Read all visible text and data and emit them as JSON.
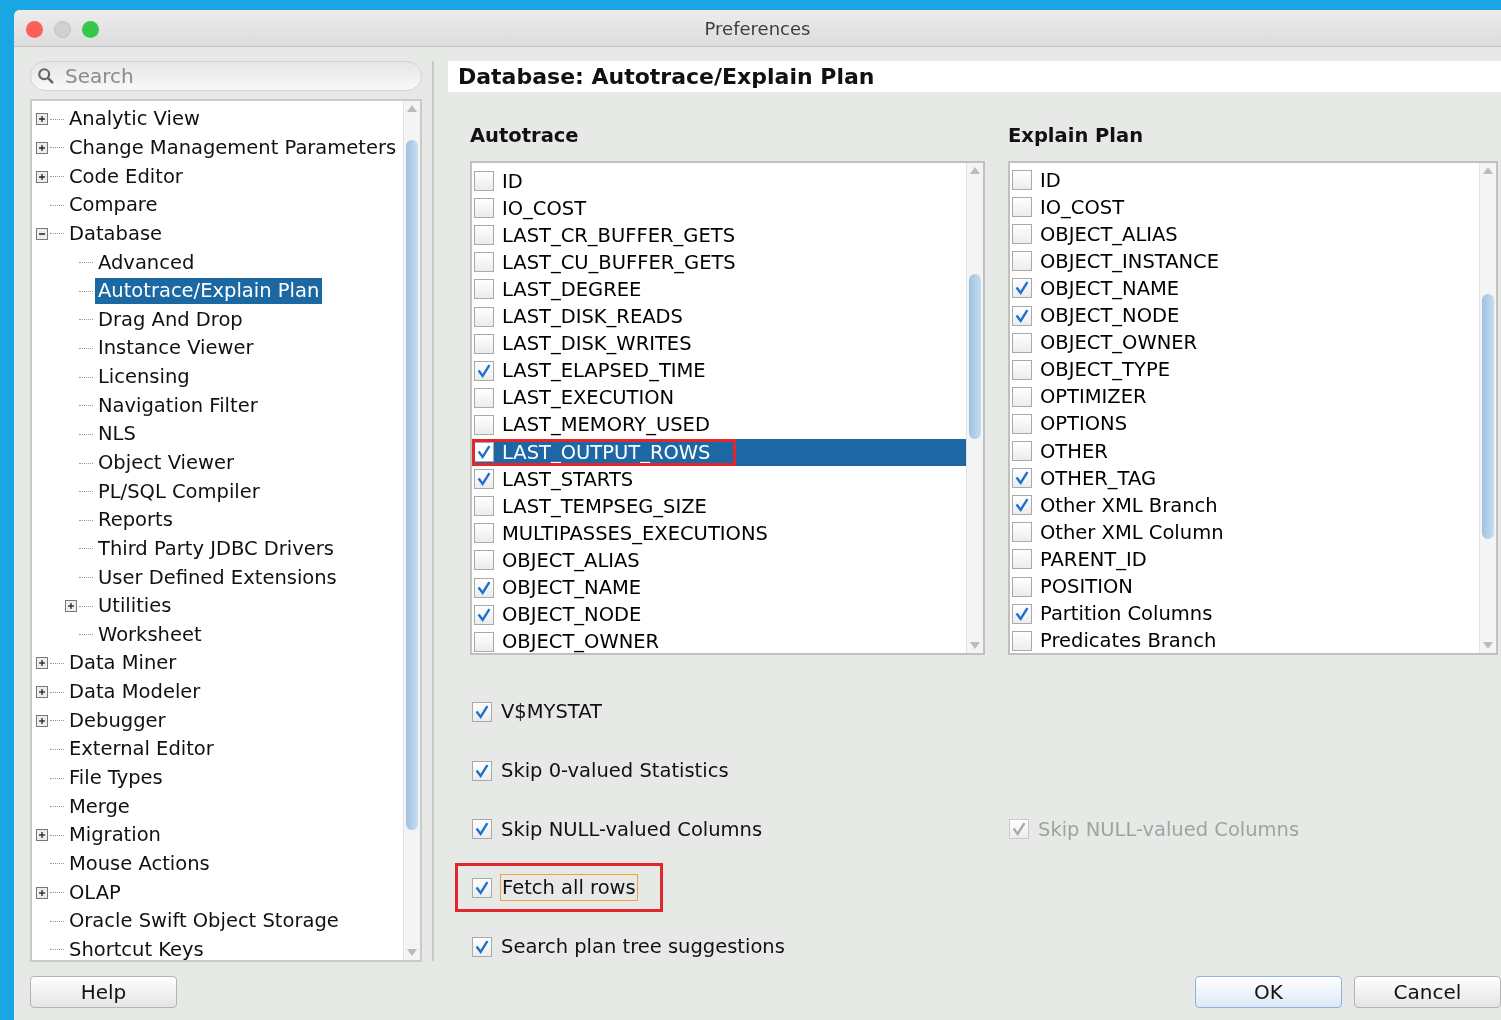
{
  "window": {
    "title": "Preferences"
  },
  "sidebar": {
    "search": {
      "placeholder": "Search"
    },
    "tree": [
      {
        "label": "Analytic View",
        "kind": "group",
        "expanded": false,
        "selected": false
      },
      {
        "label": "Change Management Parameters",
        "kind": "group",
        "expanded": false,
        "selected": false
      },
      {
        "label": "Code Editor",
        "kind": "group",
        "expanded": false,
        "selected": false
      },
      {
        "label": "Compare",
        "kind": "page",
        "selected": false
      },
      {
        "label": "Database",
        "kind": "group",
        "expanded": true,
        "selected": false,
        "children": [
          {
            "label": "Advanced",
            "kind": "page",
            "selected": false
          },
          {
            "label": "Autotrace/Explain Plan",
            "kind": "page",
            "selected": true
          },
          {
            "label": "Drag And Drop",
            "kind": "page",
            "selected": false
          },
          {
            "label": "Instance Viewer",
            "kind": "page",
            "selected": false
          },
          {
            "label": "Licensing",
            "kind": "page",
            "selected": false
          },
          {
            "label": "Navigation Filter",
            "kind": "page",
            "selected": false
          },
          {
            "label": "NLS",
            "kind": "page",
            "selected": false
          },
          {
            "label": "Object Viewer",
            "kind": "page",
            "selected": false
          },
          {
            "label": "PL/SQL Compiler",
            "kind": "page",
            "selected": false
          },
          {
            "label": "Reports",
            "kind": "page",
            "selected": false
          },
          {
            "label": "Third Party JDBC Drivers",
            "kind": "page",
            "selected": false
          },
          {
            "label": "User Defined Extensions",
            "kind": "page",
            "selected": false
          },
          {
            "label": "Utilities",
            "kind": "group",
            "expanded": false,
            "selected": false
          },
          {
            "label": "Worksheet",
            "kind": "page",
            "selected": false
          }
        ]
      },
      {
        "label": "Data Miner",
        "kind": "group",
        "expanded": false,
        "selected": false
      },
      {
        "label": "Data Modeler",
        "kind": "group",
        "expanded": false,
        "selected": false
      },
      {
        "label": "Debugger",
        "kind": "group",
        "expanded": false,
        "selected": false
      },
      {
        "label": "External Editor",
        "kind": "page",
        "selected": false
      },
      {
        "label": "File Types",
        "kind": "page",
        "selected": false
      },
      {
        "label": "Merge",
        "kind": "page",
        "selected": false
      },
      {
        "label": "Migration",
        "kind": "group",
        "expanded": false,
        "selected": false
      },
      {
        "label": "Mouse Actions",
        "kind": "page",
        "selected": false
      },
      {
        "label": "OLAP",
        "kind": "group",
        "expanded": false,
        "selected": false
      },
      {
        "label": "Oracle Swift Object Storage",
        "kind": "page",
        "selected": false
      },
      {
        "label": "Shortcut Keys",
        "kind": "page",
        "selected": false
      }
    ]
  },
  "page": {
    "title": "Database: Autotrace/Explain Plan",
    "autotrace": {
      "heading": "Autotrace",
      "columns": [
        {
          "label": "ID",
          "checked": false,
          "selected": false,
          "highlighted": false
        },
        {
          "label": "IO_COST",
          "checked": false,
          "selected": false,
          "highlighted": false
        },
        {
          "label": "LAST_CR_BUFFER_GETS",
          "checked": false,
          "selected": false,
          "highlighted": false
        },
        {
          "label": "LAST_CU_BUFFER_GETS",
          "checked": false,
          "selected": false,
          "highlighted": false
        },
        {
          "label": "LAST_DEGREE",
          "checked": false,
          "selected": false,
          "highlighted": false
        },
        {
          "label": "LAST_DISK_READS",
          "checked": false,
          "selected": false,
          "highlighted": false
        },
        {
          "label": "LAST_DISK_WRITES",
          "checked": false,
          "selected": false,
          "highlighted": false
        },
        {
          "label": "LAST_ELAPSED_TIME",
          "checked": true,
          "selected": false,
          "highlighted": false
        },
        {
          "label": "LAST_EXECUTION",
          "checked": false,
          "selected": false,
          "highlighted": false
        },
        {
          "label": "LAST_MEMORY_USED",
          "checked": false,
          "selected": false,
          "highlighted": false
        },
        {
          "label": "LAST_OUTPUT_ROWS",
          "checked": true,
          "selected": true,
          "highlighted": true
        },
        {
          "label": "LAST_STARTS",
          "checked": true,
          "selected": false,
          "highlighted": false
        },
        {
          "label": "LAST_TEMPSEG_SIZE",
          "checked": false,
          "selected": false,
          "highlighted": false
        },
        {
          "label": "MULTIPASSES_EXECUTIONS",
          "checked": false,
          "selected": false,
          "highlighted": false
        },
        {
          "label": "OBJECT_ALIAS",
          "checked": false,
          "selected": false,
          "highlighted": false
        },
        {
          "label": "OBJECT_NAME",
          "checked": true,
          "selected": false,
          "highlighted": false
        },
        {
          "label": "OBJECT_NODE",
          "checked": true,
          "selected": false,
          "highlighted": false
        },
        {
          "label": "OBJECT_OWNER",
          "checked": false,
          "selected": false,
          "highlighted": false
        }
      ]
    },
    "explain_plan": {
      "heading": "Explain Plan",
      "columns": [
        {
          "label": "ID",
          "checked": false
        },
        {
          "label": "IO_COST",
          "checked": false
        },
        {
          "label": "OBJECT_ALIAS",
          "checked": false
        },
        {
          "label": "OBJECT_INSTANCE",
          "checked": false
        },
        {
          "label": "OBJECT_NAME",
          "checked": true
        },
        {
          "label": "OBJECT_NODE",
          "checked": true
        },
        {
          "label": "OBJECT_OWNER",
          "checked": false
        },
        {
          "label": "OBJECT_TYPE",
          "checked": false
        },
        {
          "label": "OPTIMIZER",
          "checked": false
        },
        {
          "label": "OPTIONS",
          "checked": false
        },
        {
          "label": "OTHER",
          "checked": false
        },
        {
          "label": "OTHER_TAG",
          "checked": true
        },
        {
          "label": "Other XML Branch",
          "checked": true
        },
        {
          "label": "Other XML Column",
          "checked": false
        },
        {
          "label": "PARENT_ID",
          "checked": false
        },
        {
          "label": "POSITION",
          "checked": false
        },
        {
          "label": "Partition Columns",
          "checked": true
        },
        {
          "label": "Predicates Branch",
          "checked": false
        }
      ]
    },
    "options": [
      {
        "autotrace": {
          "label": "V$MYSTAT",
          "checked": true,
          "highlighted": false,
          "focused": false
        }
      },
      {
        "autotrace": {
          "label": "Skip 0-valued Statistics",
          "checked": true,
          "highlighted": false,
          "focused": false
        }
      },
      {
        "autotrace": {
          "label": "Skip NULL-valued Columns",
          "checked": true,
          "highlighted": false,
          "focused": false
        },
        "explain_plan": {
          "label": "Skip NULL-valued Columns",
          "checked": true,
          "disabled": true
        }
      },
      {
        "autotrace": {
          "label": "Fetch all rows",
          "checked": true,
          "highlighted": true,
          "focused": true
        }
      },
      {
        "autotrace": {
          "label": "Search plan tree suggestions",
          "checked": true,
          "highlighted": false,
          "focused": false
        }
      }
    ]
  },
  "buttons": [
    {
      "label": "Help",
      "kind": "secondary"
    },
    {
      "label": "OK",
      "kind": "default"
    },
    {
      "label": "Cancel",
      "kind": "secondary"
    }
  ]
}
